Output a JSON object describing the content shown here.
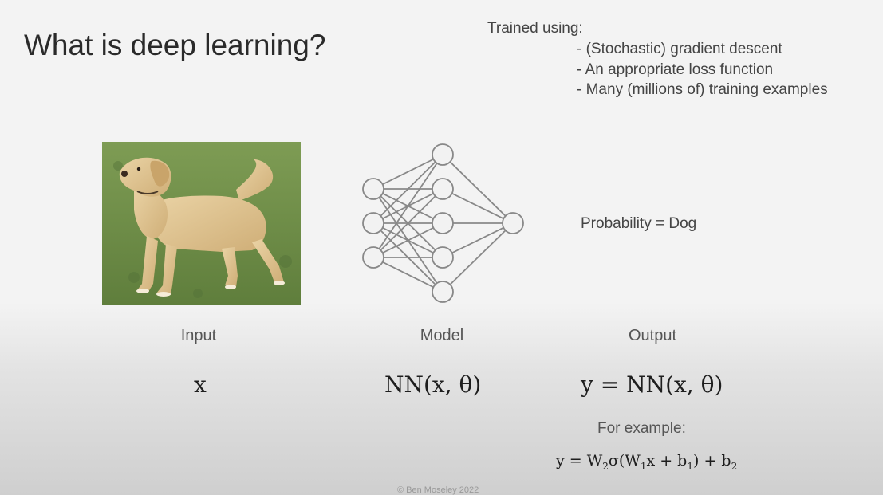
{
  "slide": {
    "title": "What is deep learning?",
    "training": {
      "heading": "Trained using:",
      "items": [
        "- (Stochastic) gradient descent",
        "- An appropriate loss function",
        "- Many (millions of) training examples"
      ]
    },
    "output_text": "Probability = Dog",
    "columns": {
      "input_label": "Input",
      "model_label": "Model",
      "output_label": "Output"
    },
    "math": {
      "input": "x",
      "model": "NN(x, θ)",
      "output": "y = NN(x, θ)",
      "example_label": "For example:",
      "example_equation": {
        "lhs": "y = W",
        "sub_w2": "2",
        "sigma_open": "σ(W",
        "sub_w1": "1",
        "mid": "x + b",
        "sub_b1": "1",
        "close": ") + b",
        "sub_b2": "2"
      }
    },
    "copyright": "© Ben Moseley 2022"
  },
  "colors": {
    "background": "#f3f3f3",
    "network_line": "#888888",
    "node_fill": "#f2f2f2",
    "grass": "#6f8f48",
    "dog_fur": "#ddc08e"
  },
  "network": {
    "layers": [
      3,
      5,
      1
    ]
  }
}
